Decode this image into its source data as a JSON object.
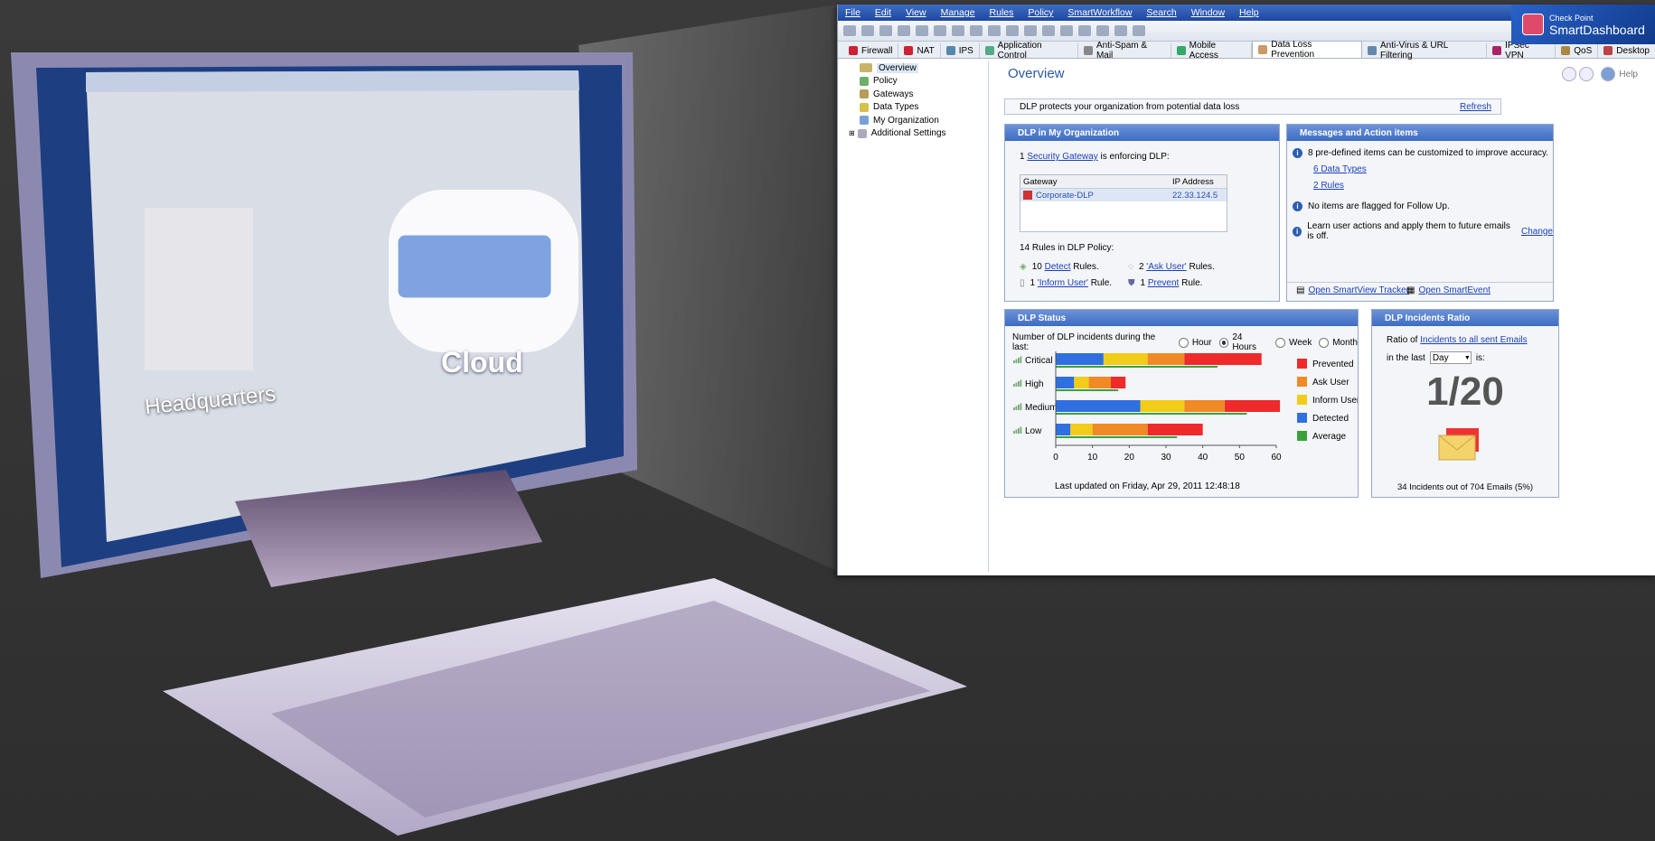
{
  "menu": [
    "File",
    "Edit",
    "View",
    "Manage",
    "Rules",
    "Policy",
    "SmartWorkflow",
    "Search",
    "Window",
    "Help"
  ],
  "brand": {
    "line1": "Check Point",
    "line2": "SmartDashboard"
  },
  "tabs": [
    "Firewall",
    "NAT",
    "IPS",
    "Application Control",
    "Anti-Spam & Mail",
    "Mobile Access",
    "Data Loss Prevention",
    "Anti-Virus & URL Filtering",
    "IPSec VPN",
    "QoS",
    "Desktop"
  ],
  "tree": [
    "Overview",
    "Policy",
    "Gateways",
    "Data Types",
    "My Organization",
    "Additional Settings"
  ],
  "page_title": "Overview",
  "help_label": "Help",
  "info_text": "DLP protects your organization from potential data loss",
  "refresh": "Refresh",
  "org_panel": {
    "title": "DLP in My Organization",
    "enforce_pre": "1",
    "enforce_link": "Security Gateway",
    "enforce_post": "is enforcing DLP:",
    "col_gateway": "Gateway",
    "col_ip": "IP Address",
    "gw_name": "Corporate-DLP",
    "gw_ip": "22.33.124.5",
    "rules_title": "14 Rules in DLP Policy:",
    "detect_count": "10",
    "detect_link": "Detect",
    "detect_post": "Rules.",
    "ask_count": "2",
    "ask_link": "'Ask User'",
    "ask_post": "Rules.",
    "inform_count": "1",
    "inform_link": "'Inform User'",
    "inform_post": "Rule.",
    "prevent_count": "1",
    "prevent_link": "Prevent",
    "prevent_post": "Rule."
  },
  "msg_panel": {
    "title": "Messages and  Action items",
    "m1": "8 pre-defined items can be customized to improve accuracy.",
    "m1a": "6 Data Types",
    "m1b": "2 Rules",
    "m2": "No items are flagged for Follow Up.",
    "m3": "Learn user actions and apply them to future emails is off.",
    "m3link": "Change",
    "tracker": "Open SmartView Tracker",
    "event": "Open SmartEvent"
  },
  "status_panel": {
    "title": "DLP Status",
    "period_label": "Number of DLP incidents during the last:",
    "periods": [
      "Hour",
      "24 Hours",
      "Week",
      "Month"
    ],
    "updated": "Last updated on Friday, Apr 29, 2011 12:48:18"
  },
  "ratio_panel": {
    "title": "DLP Incidents Ratio",
    "ratio_pre": "Ratio of",
    "ratio_link": "Incidents to all sent Emails",
    "in_last": "in the last",
    "select": "Day",
    "is": "is:",
    "ratio": "1/20",
    "summary": "34 Incidents out of 704 Emails (5%)"
  },
  "illustration": {
    "cloud": "Cloud",
    "hq": "Headquarters"
  },
  "chart_data": {
    "type": "bar",
    "orientation": "horizontal-stacked",
    "categories": [
      "Critical",
      "High",
      "Medium",
      "Low"
    ],
    "series": [
      {
        "name": "Detected",
        "color": "#2f6fe0",
        "values": [
          13,
          5,
          23,
          4
        ]
      },
      {
        "name": "Inform User",
        "color": "#f1cc19",
        "values": [
          12,
          4,
          12,
          6
        ]
      },
      {
        "name": "Ask User",
        "color": "#f08a25",
        "values": [
          10,
          6,
          11,
          15
        ]
      },
      {
        "name": "Prevented",
        "color": "#ee2a2a",
        "values": [
          21,
          4,
          15,
          15
        ]
      }
    ],
    "average": {
      "name": "Average",
      "color": "#3aa13a",
      "values": [
        44,
        17,
        52,
        33
      ]
    },
    "xlim": [
      0,
      60
    ],
    "xticks": [
      "0",
      "10",
      "20",
      "30",
      "40",
      "50",
      "60"
    ],
    "legend_position": "right"
  }
}
